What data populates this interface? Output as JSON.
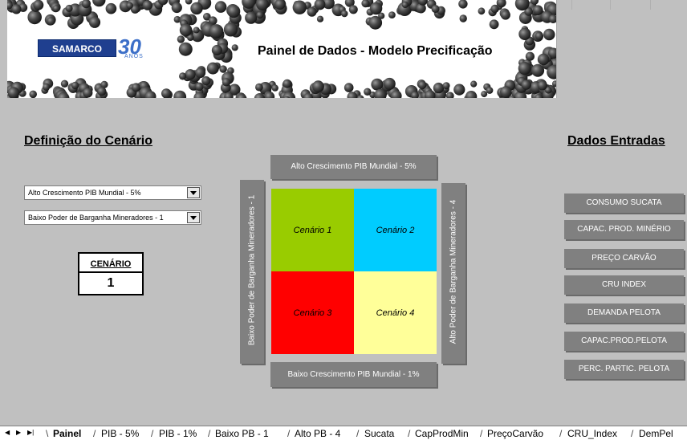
{
  "banner": {
    "logo_text": "SAMARCO",
    "logo_number": "30",
    "logo_sub": "ANOS",
    "title": "Painel de Dados - Modelo Precificação"
  },
  "left": {
    "section_title": "Definição do Cenário",
    "dropdown1": "Alto Crescimento PIB Mundial - 5%",
    "dropdown2": "Baixo Poder de Barganha Mineradores - 1",
    "cenario_label": "CENÁRIO",
    "cenario_value": "1"
  },
  "matrix": {
    "top": "Alto Crescimento PIB Mundial - 5%",
    "bottom": "Baixo Crescimento PIB Mundial - 1%",
    "left": "Baixo Poder de Barganha Mineradores - 1",
    "right": "Alto Poder de Barganha Mineradores - 4",
    "q1": "Cenário 1",
    "q2": "Cenário 2",
    "q3": "Cenário 3",
    "q4": "Cenário 4",
    "colors": {
      "q1": "#99cc00",
      "q2": "#00ccff",
      "q3": "#ff0000",
      "q4": "#ffff99"
    }
  },
  "right": {
    "section_title": "Dados Entradas",
    "buttons": [
      "CONSUMO SUCATA",
      "CAPAC. PROD. MINÉRIO",
      "PREÇO CARVÃO",
      "CRU INDEX",
      "DEMANDA PELOTA",
      "CAPAC.PROD.PELOTA",
      "PERC. PARTIC. PELOTA"
    ]
  },
  "tabs": {
    "nav_icons": [
      "first-sheet-icon",
      "next-sheet-icon",
      "last-sheet-icon"
    ],
    "items": [
      "Painel",
      "PIB - 5%",
      "PIB - 1%",
      "Baixo PB - 1",
      "Alto PB - 4",
      "Sucata",
      "CapProdMin",
      "PreçoCarvão",
      "CRU_Index",
      "DemPel"
    ]
  }
}
